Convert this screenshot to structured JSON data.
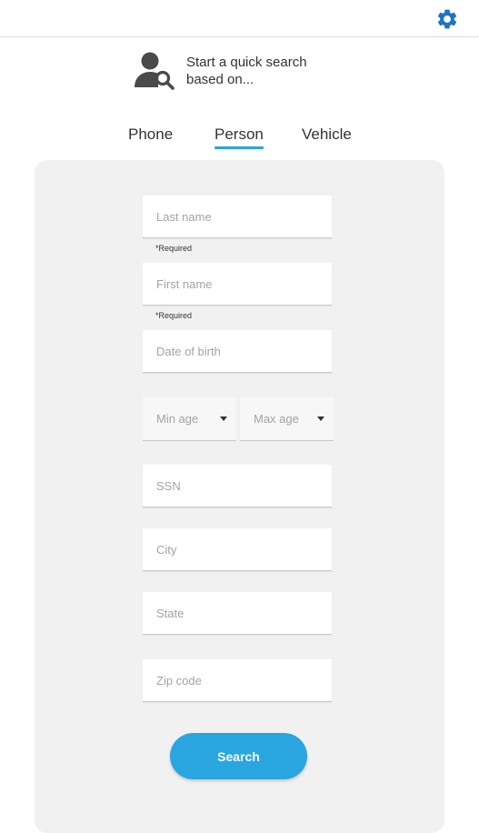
{
  "colors": {
    "accent": "#29a6e0",
    "gear": "#1f73c8",
    "panel": "#f1f1f1"
  },
  "header": {
    "settings_icon": "gear-icon"
  },
  "intro": {
    "icon": "person-search-icon",
    "text": "Start a quick search\nbased on..."
  },
  "tabs": [
    {
      "label": "Phone",
      "active": false
    },
    {
      "label": "Person",
      "active": true
    },
    {
      "label": "Vehicle",
      "active": false
    }
  ],
  "form": {
    "last_name": {
      "placeholder": "Last name",
      "value": "",
      "hint": "*Required"
    },
    "first_name": {
      "placeholder": "First name",
      "value": "",
      "hint": "*Required"
    },
    "dob": {
      "placeholder": "Date of birth",
      "value": ""
    },
    "min_age": {
      "label": "Min age"
    },
    "max_age": {
      "label": "Max age"
    },
    "ssn": {
      "placeholder": "SSN",
      "value": ""
    },
    "city": {
      "placeholder": "City",
      "value": ""
    },
    "state": {
      "placeholder": "State",
      "value": ""
    },
    "zip": {
      "placeholder": "Zip code",
      "value": ""
    },
    "submit_label": "Search"
  }
}
